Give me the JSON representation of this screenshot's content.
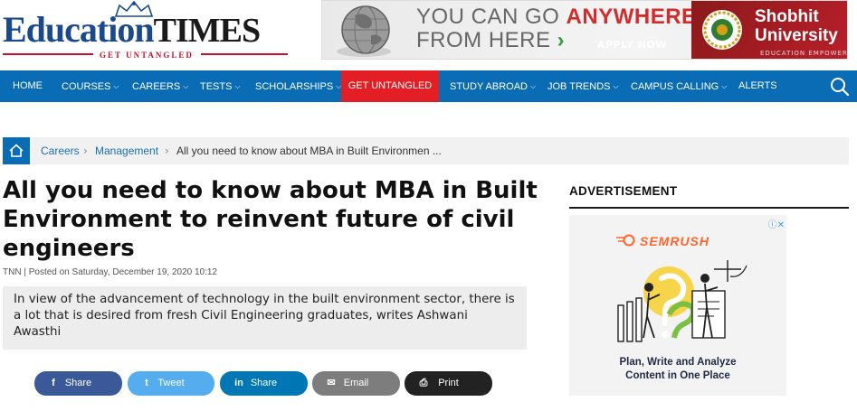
{
  "header": {
    "logo_main": "Education",
    "logo_times": "TIMES",
    "logo_tagline": "GET UNTANGLED"
  },
  "ad_banner": {
    "line1_prefix": "YOU CAN GO ",
    "line1_highlight": "ANYWHERE",
    "line2": "FROM HERE",
    "line2_arrow": "›",
    "cta": "APPLY NOW",
    "brand_line1": "Shobhit",
    "brand_line2": "University",
    "brand_tagline": "EDUCATION EMPOWERS"
  },
  "nav": {
    "items": [
      {
        "label": "HOME",
        "dropdown": false
      },
      {
        "label": "COURSES",
        "dropdown": true
      },
      {
        "label": "CAREERS",
        "dropdown": true
      },
      {
        "label": "TESTS",
        "dropdown": true
      },
      {
        "label": "SCHOLARSHIPS",
        "dropdown": true
      },
      {
        "label": "GET UNTANGLED",
        "dropdown": false,
        "active": true
      },
      {
        "label": "STUDY ABROAD",
        "dropdown": true
      },
      {
        "label": "JOB TRENDS",
        "dropdown": true
      },
      {
        "label": "CAMPUS CALLING",
        "dropdown": true
      },
      {
        "label": "ALERTS",
        "dropdown": false
      }
    ],
    "chevron": "⌄",
    "search_icon": "search-icon",
    "bar_color": "#0a6cb5",
    "active_color": "#e31e24"
  },
  "breadcrumb": {
    "home_icon": "home-icon",
    "items": [
      "Careers",
      "Management"
    ],
    "current": "All you need to know about MBA in Built Environmen ...",
    "separator": "›"
  },
  "article": {
    "title": "All you need to know about MBA in Built Environment to reinvent future of civil engineers",
    "meta": "TNN | Posted on Saturday, December 19, 2020 10:12",
    "summary": "In view of the advancement of technology in the built environment sector, there is a lot that is desired from fresh Civil Engineering graduates, writes Ashwani Awasthi"
  },
  "share_buttons": [
    {
      "icon": "f",
      "label": "Share",
      "network": "facebook",
      "color": "#3b5998"
    },
    {
      "icon": "t",
      "label": "Tweet",
      "network": "twitter",
      "color": "#55acee"
    },
    {
      "icon": "in",
      "label": "Share",
      "network": "linkedin",
      "color": "#0077b5"
    },
    {
      "icon": "✉",
      "label": "Email",
      "network": "email",
      "color": "#7d7d7d"
    },
    {
      "icon": "⎙",
      "label": "Print",
      "network": "print",
      "color": "#222222"
    }
  ],
  "sidebar": {
    "heading": "ADVERTISEMENT",
    "ad_brand": "SEMRUSH",
    "ad_caption_line1": "Plan, Write and Analyze",
    "ad_caption_line2": "Content in One Place",
    "ad_badge": "ⓘ✕"
  }
}
